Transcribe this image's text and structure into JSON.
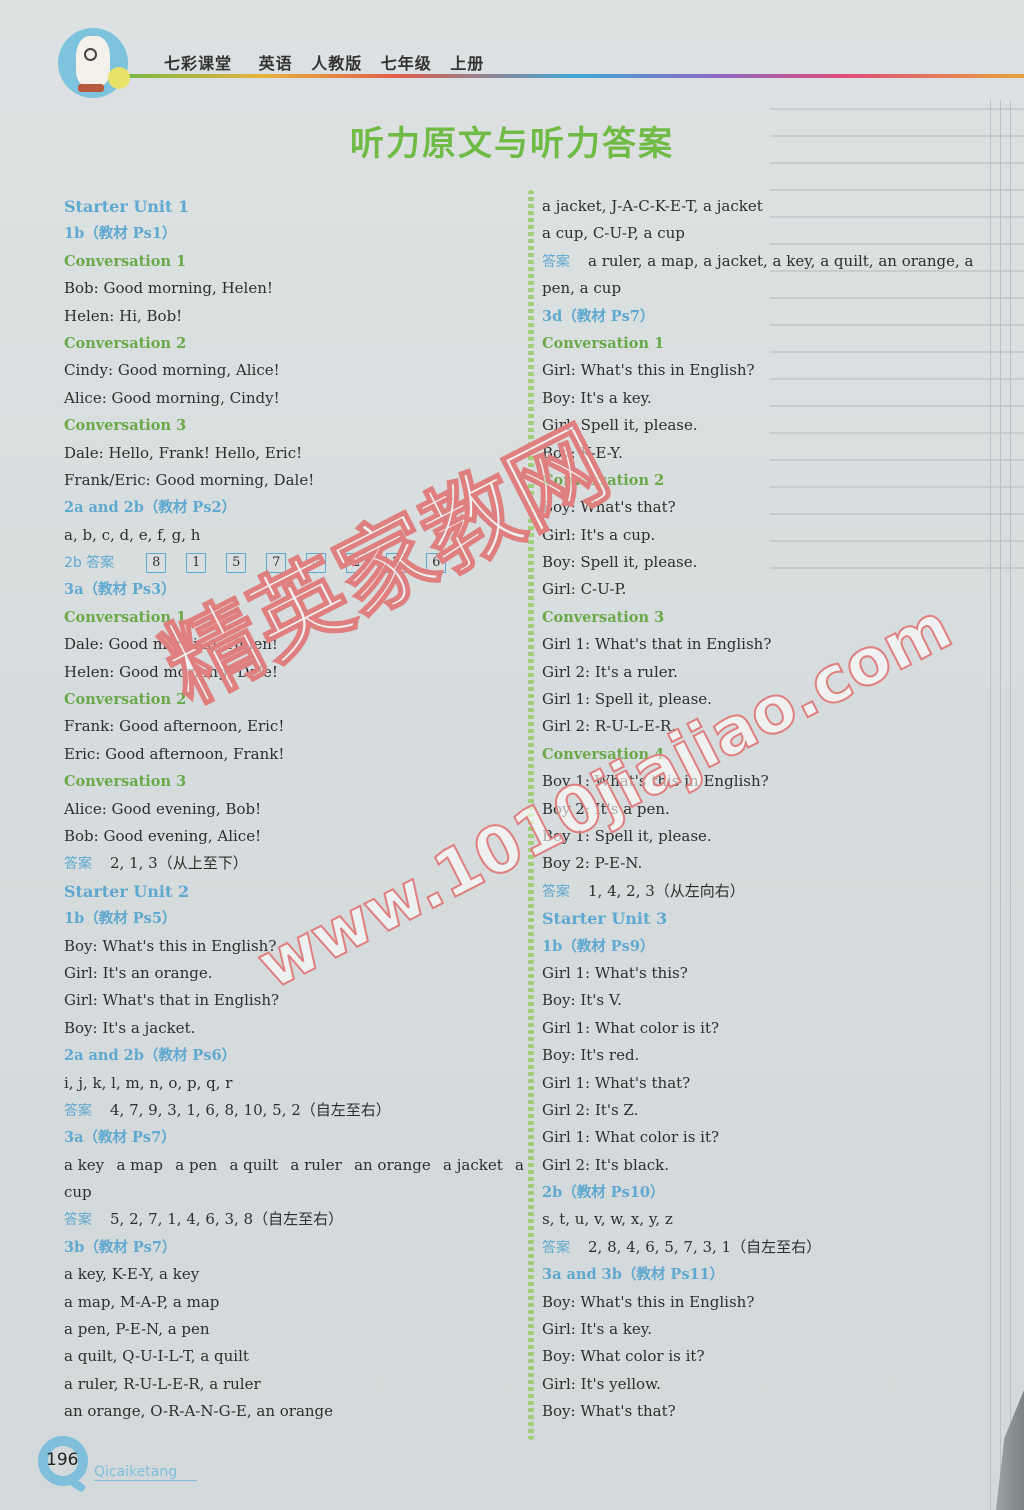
{
  "header": {
    "series": "七彩课堂",
    "subject": "英语",
    "edition": "人教版",
    "grade": "七年级",
    "volume": "上册",
    "logo_icon": "cartoon-dog-logo"
  },
  "page_title": "听力原文与听力答案",
  "left_column": [
    {
      "type": "unit",
      "text": "Starter Unit 1"
    },
    {
      "type": "sect",
      "text": "1b（教材 Ps1）"
    },
    {
      "type": "conv",
      "text": "Conversation 1"
    },
    {
      "type": "text",
      "text": "Bob: Good morning, Helen!"
    },
    {
      "type": "text",
      "text": "Helen: Hi, Bob!"
    },
    {
      "type": "conv",
      "text": "Conversation 2"
    },
    {
      "type": "text",
      "text": "Cindy: Good morning, Alice!"
    },
    {
      "type": "text",
      "text": "Alice: Good morning, Cindy!"
    },
    {
      "type": "conv",
      "text": "Conversation 3"
    },
    {
      "type": "text",
      "text": "Dale: Hello, Frank! Hello, Eric!"
    },
    {
      "type": "text",
      "text": "Frank/Eric: Good morning, Dale!"
    },
    {
      "type": "sect",
      "text": "2a and 2b（教材 Ps2）"
    },
    {
      "type": "text",
      "text": "a, b, c, d, e, f, g, h"
    },
    {
      "type": "boxes",
      "label": "2b 答案",
      "values": [
        "8",
        "1",
        "5",
        "7",
        "4",
        "2",
        "3",
        "6"
      ]
    },
    {
      "type": "sect",
      "text": "3a（教材 Ps3）"
    },
    {
      "type": "conv",
      "text": "Conversation 1"
    },
    {
      "type": "text",
      "text": "Dale: Good morning, Helen!"
    },
    {
      "type": "text",
      "text": "Helen: Good morning, Dale!"
    },
    {
      "type": "conv",
      "text": "Conversation 2"
    },
    {
      "type": "text",
      "text": "Frank: Good afternoon, Eric!"
    },
    {
      "type": "text",
      "text": "Eric: Good afternoon, Frank!"
    },
    {
      "type": "conv",
      "text": "Conversation 3"
    },
    {
      "type": "text",
      "text": "Alice: Good evening, Bob!"
    },
    {
      "type": "text",
      "text": "Bob: Good evening, Alice!"
    },
    {
      "type": "answer",
      "label": "答案",
      "text": "2, 1, 3（从上至下）"
    },
    {
      "type": "unit",
      "text": "Starter Unit 2"
    },
    {
      "type": "sect",
      "text": "1b（教材 Ps5）"
    },
    {
      "type": "text",
      "text": "Boy: What's this in English?"
    },
    {
      "type": "text",
      "text": "Girl: It's an orange."
    },
    {
      "type": "text",
      "text": "Girl: What's that in English?"
    },
    {
      "type": "text",
      "text": "Boy: It's a jacket."
    },
    {
      "type": "sect",
      "text": "2a and 2b（教材 Ps6）"
    },
    {
      "type": "text",
      "text": "i, j, k, l, m, n, o, p, q, r"
    },
    {
      "type": "answer",
      "label": "答案",
      "text": "4, 7, 9, 3, 1, 6, 8, 10, 5, 2（自左至右）"
    },
    {
      "type": "sect",
      "text": "3a（教材 Ps7）"
    },
    {
      "type": "spread",
      "items": [
        "a key",
        "a map",
        "a pen",
        "a quilt",
        "a ruler",
        "an orange",
        "a jacket",
        "a"
      ]
    },
    {
      "type": "text",
      "text": "cup"
    },
    {
      "type": "answer",
      "label": "答案",
      "text": "5, 2, 7, 1, 4, 6, 3, 8（自左至右）"
    },
    {
      "type": "sect",
      "text": "3b（教材 Ps7）"
    },
    {
      "type": "text",
      "text": "a key, K-E-Y, a key"
    },
    {
      "type": "text",
      "text": "a map, M-A-P, a map"
    },
    {
      "type": "text",
      "text": "a pen, P-E-N, a pen"
    },
    {
      "type": "text",
      "text": "a quilt, Q-U-I-L-T, a quilt"
    },
    {
      "type": "text",
      "text": "a ruler, R-U-L-E-R, a ruler"
    },
    {
      "type": "text",
      "text": "an orange, O-R-A-N-G-E, an orange"
    }
  ],
  "right_column": [
    {
      "type": "text",
      "text": "a jacket, J-A-C-K-E-T, a jacket"
    },
    {
      "type": "text",
      "text": "a cup, C-U-P, a cup"
    },
    {
      "type": "answer",
      "label": "答案",
      "text": "a ruler, a map, a jacket, a key, a quilt, an orange, a"
    },
    {
      "type": "text",
      "text": "pen, a cup"
    },
    {
      "type": "sect",
      "text": "3d（教材 Ps7）"
    },
    {
      "type": "conv",
      "text": "Conversation 1"
    },
    {
      "type": "text",
      "text": "Girl: What's this in English?"
    },
    {
      "type": "text",
      "text": "Boy: It's a key."
    },
    {
      "type": "text",
      "text": "Girl: Spell it, please."
    },
    {
      "type": "text",
      "text": "Boy: K-E-Y."
    },
    {
      "type": "conv",
      "text": "Conversation 2"
    },
    {
      "type": "text",
      "text": "Boy: What's that?"
    },
    {
      "type": "text",
      "text": "Girl: It's a cup."
    },
    {
      "type": "text",
      "text": "Boy: Spell it, please."
    },
    {
      "type": "text",
      "text": "Girl: C-U-P."
    },
    {
      "type": "conv",
      "text": "Conversation 3"
    },
    {
      "type": "text",
      "text": "Girl 1: What's that in English?"
    },
    {
      "type": "text",
      "text": "Girl 2: It's a ruler."
    },
    {
      "type": "text",
      "text": "Girl 1: Spell it, please."
    },
    {
      "type": "text",
      "text": "Girl 2: R-U-L-E-R."
    },
    {
      "type": "conv",
      "text": "Conversation 4"
    },
    {
      "type": "text",
      "text": "Boy 1: What's this in English?"
    },
    {
      "type": "text",
      "text": "Boy 2: It's a pen."
    },
    {
      "type": "text",
      "text": "Boy 1: Spell it, please."
    },
    {
      "type": "text",
      "text": "Boy 2: P-E-N."
    },
    {
      "type": "answer",
      "label": "答案",
      "text": "1, 4, 2, 3（从左向右）"
    },
    {
      "type": "unit",
      "text": "Starter Unit 3"
    },
    {
      "type": "sect",
      "text": "1b（教材 Ps9）"
    },
    {
      "type": "text",
      "text": "Girl 1: What's this?"
    },
    {
      "type": "text",
      "text": "Boy: It's V."
    },
    {
      "type": "text",
      "text": "Girl 1: What color is it?"
    },
    {
      "type": "text",
      "text": "Boy: It's red."
    },
    {
      "type": "text",
      "text": "Girl 1: What's that?"
    },
    {
      "type": "text",
      "text": "Girl 2: It's Z."
    },
    {
      "type": "text",
      "text": "Girl 1: What color is it?"
    },
    {
      "type": "text",
      "text": "Girl 2: It's black."
    },
    {
      "type": "sect",
      "text": "2b（教材 Ps10）"
    },
    {
      "type": "text",
      "text": "s, t, u, v, w, x, y, z"
    },
    {
      "type": "answer",
      "label": "答案",
      "text": "2, 8, 4, 6, 5, 7, 3, 1（自左至右）"
    },
    {
      "type": "sect",
      "text": "3a and 3b（教材 Ps11）"
    },
    {
      "type": "text",
      "text": "Boy: What's this in English?"
    },
    {
      "type": "text",
      "text": "Girl: It's a key."
    },
    {
      "type": "text",
      "text": "Boy: What color is it?"
    },
    {
      "type": "text",
      "text": "Girl: It's yellow."
    },
    {
      "type": "text",
      "text": "Boy: What's that?"
    }
  ],
  "footer": {
    "page_number": "196",
    "brand": "Qicaiketang"
  },
  "watermark": {
    "site_name": "精英家教网",
    "url": "www.1010jiajiao.com"
  },
  "colors": {
    "title_green": "#6fbb45",
    "heading_blue": "#5fa8cf",
    "conversation_green": "#6aa84a",
    "watermark_red": "#e07f7f"
  }
}
